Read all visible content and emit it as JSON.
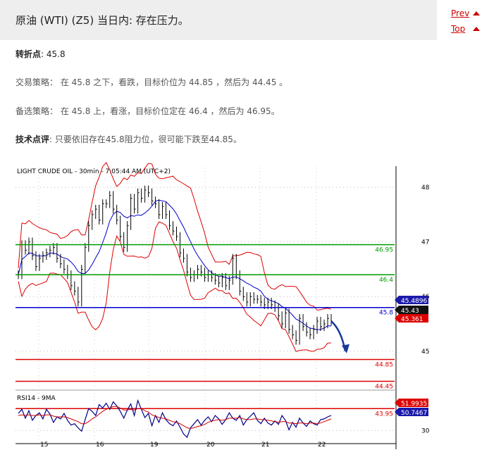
{
  "header": {
    "title": "原油 (WTI) (Z5) 当日内: 存在压力。",
    "prev_label": "Prev",
    "top_label": "Top"
  },
  "analysis": {
    "pivot_label": "转折点",
    "pivot_value": ": 45.8",
    "strategy_label": "交易策略：",
    "strategy_text": " 在 45.8 之下，看跌，目标价位为 44.85 ，然后为 44.45 。",
    "alt_label": "备选策略：",
    "alt_text": " 在 45.8 上，看涨，目标价位定在 46.4 ，然后为 46.95。",
    "comment_label": "技术点评",
    "comment_text": ": 只要依旧存在45.8阻力位，很可能下跌至44.85。"
  },
  "colors": {
    "resistance_line": "#009900",
    "pivot_line": "#0000cc",
    "support_line": "#dd0000",
    "bollinger": "#dd0000",
    "moving_average": "#0000cc",
    "price_bars": "#000000",
    "header_bg": "#eeeeee",
    "link": "#cc0000"
  },
  "chart_data": [
    {
      "type": "line",
      "title": "LIGHT CRUDE OIL - 30min - 7:05:44 AM (UTC+2)",
      "x_ticks": [
        "15",
        "16",
        "19",
        "20",
        "21",
        "22"
      ],
      "y_ticks": [
        45,
        46,
        47,
        48
      ],
      "ylim": [
        44.2,
        48.4
      ],
      "grid": true,
      "price_approx": [
        46.4,
        46.95,
        46.85,
        47.0,
        46.75,
        46.55,
        46.7,
        46.75,
        46.8,
        46.85,
        46.9,
        46.7,
        46.6,
        46.5,
        46.4,
        46.2,
        46.1,
        45.9,
        46.5,
        46.9,
        47.3,
        47.5,
        47.6,
        47.4,
        47.7,
        47.7,
        47.85,
        47.6,
        47.4,
        47.1,
        46.9,
        47.3,
        47.8,
        47.6,
        47.9,
        47.8,
        47.95,
        47.9,
        47.75,
        47.7,
        47.5,
        47.65,
        47.5,
        47.3,
        47.2,
        47.1,
        46.8,
        46.7,
        46.45,
        46.35,
        46.4,
        46.5,
        46.45,
        46.35,
        46.4,
        46.35,
        46.3,
        46.25,
        46.35,
        46.2,
        46.3,
        46.7,
        46.4,
        46.1,
        46.0,
        45.9,
        46.0,
        45.95,
        45.95,
        45.9,
        45.85,
        45.9,
        45.85,
        45.8,
        45.65,
        45.5,
        45.7,
        45.4,
        45.3,
        45.2,
        45.6,
        45.45,
        45.35,
        45.3,
        45.4,
        45.55,
        45.45,
        45.5,
        45.6,
        45.55
      ],
      "levels": [
        {
          "label": "46.95",
          "value": 46.95,
          "kind": "resistance"
        },
        {
          "label": "46.4",
          "value": 46.4,
          "kind": "resistance"
        },
        {
          "label": "45.8",
          "value": 45.8,
          "kind": "pivot"
        },
        {
          "label": "44.85",
          "value": 44.85,
          "kind": "support"
        },
        {
          "label": "44.45",
          "value": 44.45,
          "kind": "support"
        },
        {
          "label": "43.95",
          "value": 43.95,
          "kind": "support"
        }
      ],
      "price_tags": [
        {
          "label": "45.4896",
          "value": 45.4896,
          "bg": "#1a1aaa",
          "fg": "#ffffff"
        },
        {
          "label": "45.43",
          "value": 45.43,
          "bg": "#111111",
          "fg": "#ffffff"
        },
        {
          "label": "45.361",
          "value": 45.361,
          "bg": "#dd0000",
          "fg": "#ffffff"
        }
      ],
      "projection": {
        "from": 45.55,
        "to": 45.0
      }
    },
    {
      "type": "line",
      "title": "RSI14 - 9MA",
      "y_ticks": [
        30
      ],
      "ylim": [
        15,
        85
      ],
      "grid": true,
      "series": [
        {
          "values": [
            55,
            61,
            48,
            59,
            45,
            52,
            56,
            47,
            61,
            54,
            42,
            50,
            47,
            55,
            45,
            38,
            40,
            34,
            29,
            46,
            62,
            58,
            52,
            68,
            63,
            70,
            61,
            72,
            66,
            58,
            48,
            60,
            69,
            52,
            74,
            61,
            49,
            55,
            37,
            52,
            42,
            56,
            46,
            40,
            37,
            44,
            35,
            25,
            20,
            34,
            40,
            46,
            38,
            45,
            50,
            43,
            52,
            47,
            39,
            46,
            56,
            48,
            45,
            52,
            38,
            46,
            51,
            56,
            45,
            40,
            48,
            41,
            38,
            44,
            39,
            52,
            45,
            31,
            42,
            35,
            48,
            41,
            36,
            44,
            40,
            38,
            46,
            47,
            50,
            52
          ],
          "color": "#000088"
        },
        {
          "values": [
            52,
            53,
            52,
            53,
            52,
            52,
            53,
            52,
            53,
            53,
            51,
            50,
            50,
            50,
            49,
            47,
            45,
            43,
            40,
            40,
            43,
            47,
            50,
            54,
            58,
            61,
            63,
            65,
            65,
            63,
            60,
            60,
            61,
            60,
            62,
            62,
            59,
            57,
            53,
            51,
            49,
            48,
            47,
            45,
            43,
            42,
            40,
            37,
            34,
            33,
            34,
            36,
            37,
            39,
            42,
            44,
            45,
            46,
            45,
            46,
            48,
            48,
            48,
            49,
            47,
            46,
            46,
            47,
            47,
            46,
            46,
            45,
            44,
            43,
            42,
            43,
            43,
            41,
            41,
            40,
            41,
            41,
            40,
            41,
            41,
            40,
            41,
            43,
            45,
            47
          ],
          "color": "#cc0000"
        }
      ],
      "value_tags": [
        {
          "label": "51.9935",
          "value": 51.9935,
          "bg": "#dd0000",
          "fg": "#ffffff"
        },
        {
          "label": "50.7467",
          "value": 50.7467,
          "bg": "#1a1aaa",
          "fg": "#ffffff"
        }
      ]
    }
  ]
}
